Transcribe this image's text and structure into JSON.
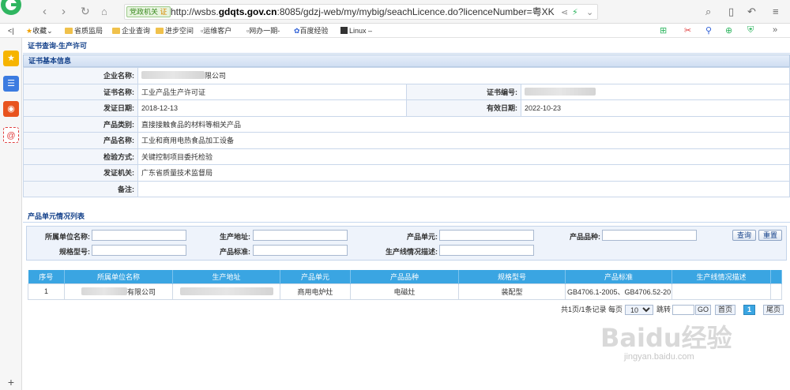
{
  "browser": {
    "address_badge": "党政机关",
    "address_badge_mark": "证",
    "url_prefix": "http://wsbs.",
    "url_domain": "gdqts.gov.cn",
    "url_rest": ":8085/gdzj-web/my/mybig/seachLicence.do?licenceNumber=粤XK",
    "bookmarks": [
      "收藏",
      "省质监局",
      "企业查询",
      "进步空间",
      "运维客户",
      "网办一期-",
      "百度经验",
      "Linux –"
    ]
  },
  "page": {
    "title": "证书查询-生产许可",
    "section_basic": "证书基本信息",
    "list_title": "产品单元情况列表"
  },
  "info": {
    "company_label": "企业名称:",
    "company_value_suffix": "限公司",
    "cert_name_label": "证书名称:",
    "cert_name_value": "工业产品生产许可证",
    "cert_no_label": "证书编号:",
    "issue_date_label": "发证日期:",
    "issue_date_value": "2018-12-13",
    "valid_date_label": "有效日期:",
    "valid_date_value": "2022-10-23",
    "category_label": "产品类别:",
    "category_value": "直接接触食品的材料等相关产品",
    "product_label": "产品名称:",
    "product_value": "工业和商用电热食品加工设备",
    "inspect_label": "检验方式:",
    "inspect_value": "关键控制项目委托检验",
    "authority_label": "发证机关:",
    "authority_value": "广东省质量技术监督局",
    "remark_label": "备注:"
  },
  "search": {
    "unit_name_label": "所属单位名称:",
    "address_label": "生产地址:",
    "product_unit_label": "产品单元:",
    "variety_label": "产品品种:",
    "model_label": "规格型号:",
    "standard_label": "产品标准:",
    "line_desc_label": "生产线情况描述:",
    "query_button": "查询",
    "reset_button": "重置"
  },
  "grid": {
    "headers": [
      "序号",
      "所属单位名称",
      "生产地址",
      "产品单元",
      "产品品种",
      "规格型号",
      "产品标准",
      "生产线情况描述"
    ],
    "rows": [
      {
        "no": "1",
        "unit_suffix": "有限公司",
        "product_unit": "商用电炉灶",
        "variety": "电磁灶",
        "model": "装配型",
        "standard": "GB4706.1-2005、GB4706.52-20"
      }
    ]
  },
  "pager": {
    "summary": "共1页/1条记录 每页",
    "page_size": "10",
    "jump_label": "跳转",
    "go_button": "GO",
    "first_button": "首页",
    "current_page": "1",
    "last_button": "尾页"
  },
  "watermark": {
    "brand": "Baidu经验",
    "site": "jingyan.baidu.com"
  },
  "colors": {
    "header_blue": "#3aa5e2",
    "title_blue": "#15428b",
    "accent_green": "#3a8a1f"
  }
}
